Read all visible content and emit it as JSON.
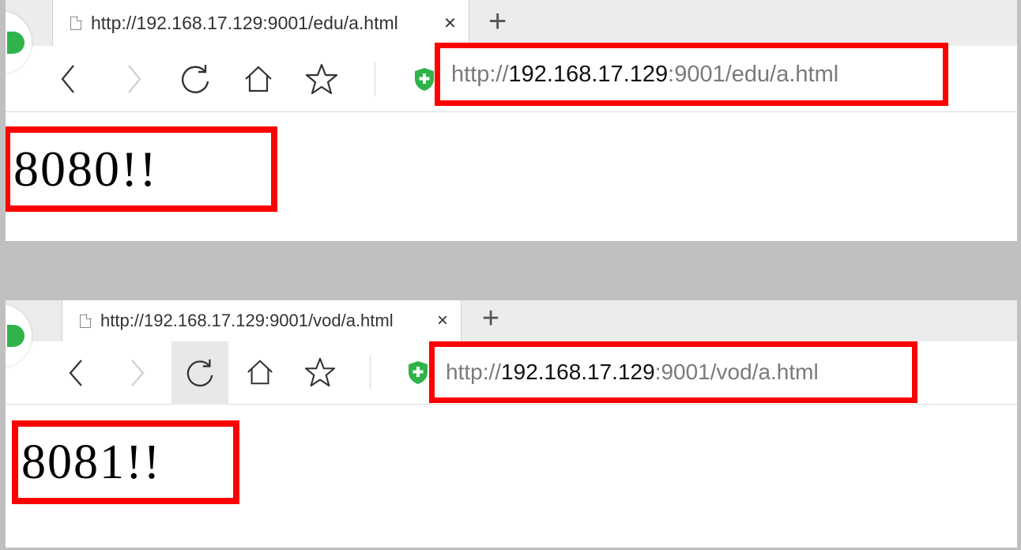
{
  "windows": [
    {
      "tab_title": "http://192.168.17.129:9001/edu/a.html",
      "tab_close": "×",
      "new_tab": "+",
      "url": {
        "scheme": "http://",
        "host": "192.168.17.129",
        "rest": ":9001/edu/a.html"
      },
      "page_text": "8080!!"
    },
    {
      "tab_title": "http://192.168.17.129:9001/vod/a.html",
      "tab_close": "×",
      "new_tab": "+",
      "url": {
        "scheme": "http://",
        "host": "192.168.17.129",
        "rest": ":9001/vod/a.html"
      },
      "page_text": "8081!!"
    }
  ],
  "icons": {
    "back": "chevron-left-icon",
    "forward": "chevron-right-icon",
    "reload": "reload-icon",
    "home": "home-icon",
    "favorite": "star-icon",
    "security": "shield-icon",
    "page": "page-icon",
    "close": "close-icon",
    "logo": "browser-logo"
  },
  "colors": {
    "highlight": "#ff0000",
    "logo_green": "#2fb34a",
    "shield_green": "#2fb34a",
    "frame": "#c0c0c0",
    "tabstrip": "#ececec"
  }
}
